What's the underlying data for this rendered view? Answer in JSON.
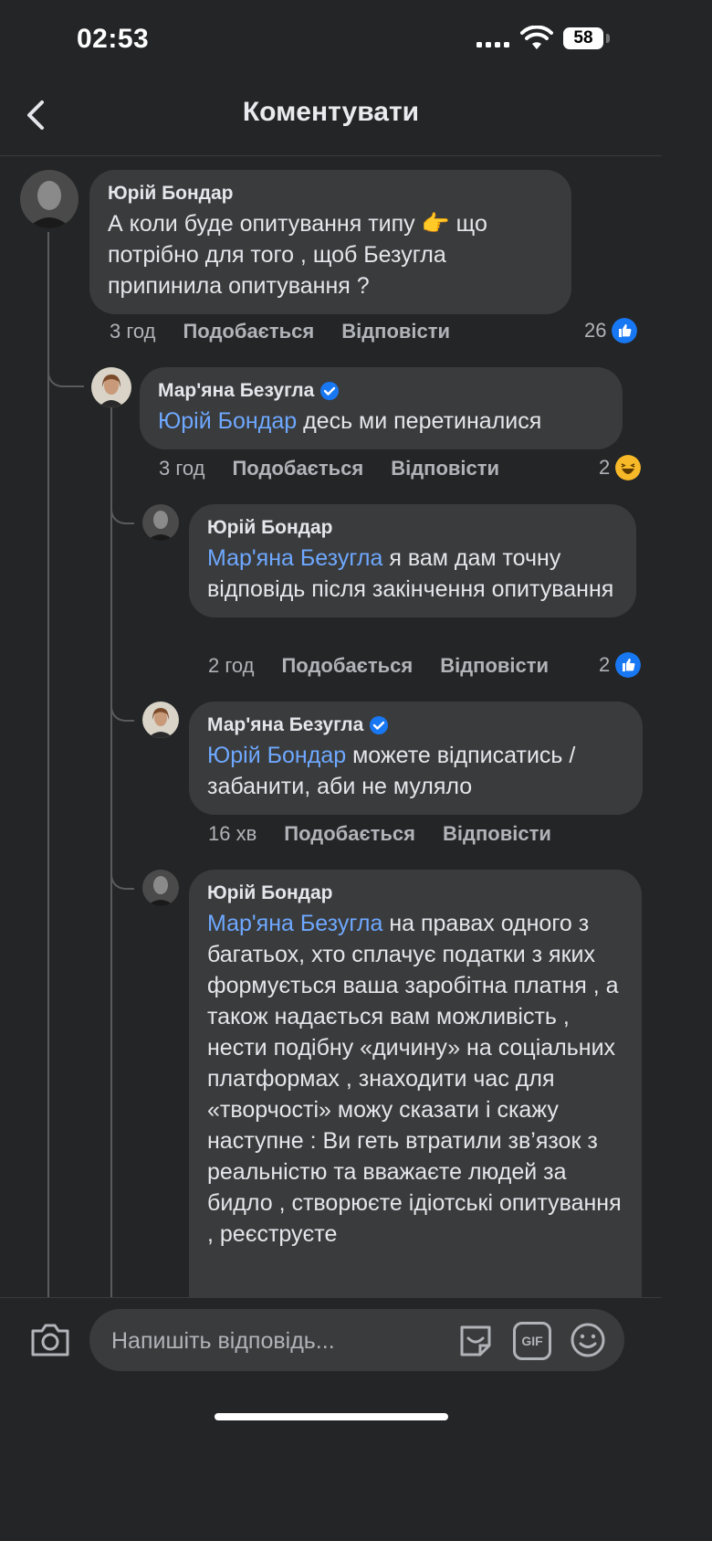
{
  "status_bar": {
    "time": "02:53",
    "battery": "58"
  },
  "header": {
    "title": "Коментувати"
  },
  "comments": [
    {
      "author": "Юрій Бондар",
      "mention": "",
      "text": "А коли буде опитування типу 👉 що потрібно для того , щоб Безугла припинила опитування ?",
      "time": "3 год",
      "like_label": "Подобається",
      "reply_label": "Відповісти",
      "reactions": "26",
      "reaction_icon": "like-icon",
      "verified": false
    },
    {
      "author": "Мар'яна Безугла",
      "mention": "Юрій Бондар",
      "text": " десь ми перетиналися",
      "time": "3 год",
      "like_label": "Подобається",
      "reply_label": "Відповісти",
      "reactions": "2",
      "reaction_icon": "haha-icon",
      "verified": true
    },
    {
      "author": "Юрій Бондар",
      "mention": "Мар'яна Безугла",
      "text": " я вам дам точну відповідь після закінчення опитування",
      "time": "2 год",
      "like_label": "Подобається",
      "reply_label": "Відповісти",
      "reactions": "2",
      "reaction_icon": "like-icon",
      "verified": false
    },
    {
      "author": "Мар'яна Безугла",
      "mention": "Юрій Бондар",
      "text": " можете відписатись / забанити, аби не муляло",
      "time": "16 хв",
      "like_label": "Подобається",
      "reply_label": "Відповісти",
      "reactions": "",
      "reaction_icon": "",
      "verified": true
    },
    {
      "author": "Юрій Бондар",
      "mention": "Мар'яна Безугла",
      "text": " на правах одного з багатьох, хто сплачує податки з яких формується ваша заробітна платня , а також надається вам можливість , нести подібну «дичину» на соціальних платформах , знаходити час для «творчості» можу сказати і скажу наступне : Ви геть втратили зв’язок з реальністю та вважаєте людей за бидло , створюєте ідіотські опитування , реєструєте",
      "time": "",
      "like_label": "",
      "reply_label": "",
      "reactions": "",
      "reaction_icon": "",
      "verified": false
    }
  ],
  "composer": {
    "placeholder": "Напишіть відповідь...",
    "gif_label": "GIF"
  },
  "colors": {
    "background": "#242526",
    "bubble": "#3a3b3c",
    "mention": "#6ea8ff",
    "like_blue": "#1877f2",
    "haha_yellow": "#f7b928"
  }
}
